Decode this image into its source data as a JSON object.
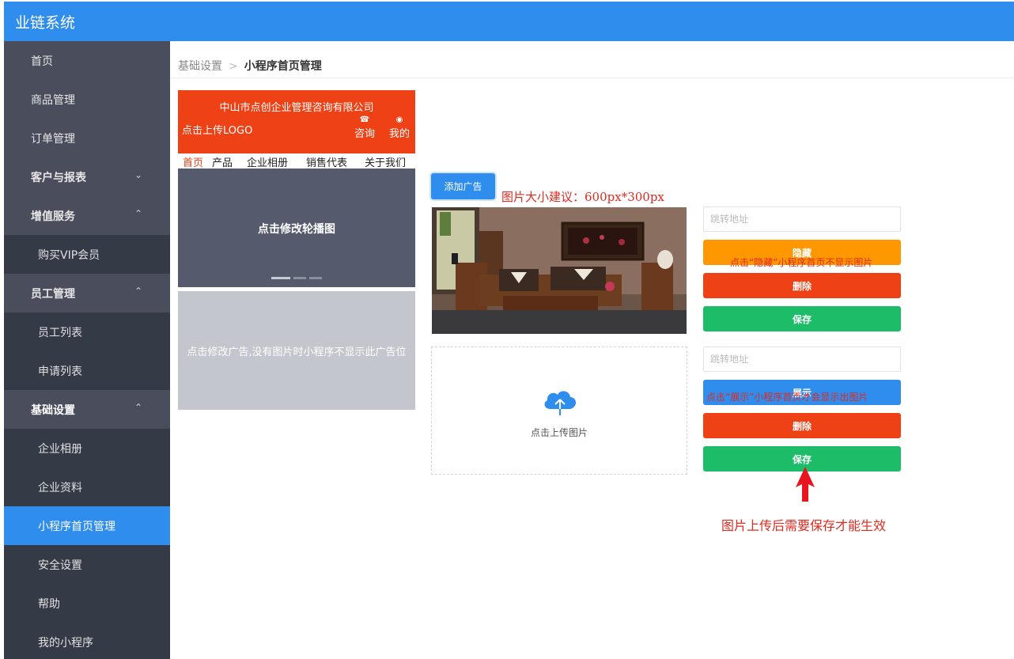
{
  "app": {
    "title": "业链系统"
  },
  "sidebar": {
    "items": [
      {
        "label": "首页"
      },
      {
        "label": "商品管理"
      },
      {
        "label": "订单管理"
      },
      {
        "label": "客户与报表",
        "arrow": "⌄"
      },
      {
        "label": "增值服务",
        "arrow": "⌃"
      },
      {
        "label": "购买VIP会员"
      },
      {
        "label": "员工管理",
        "arrow": "⌃"
      },
      {
        "label": "员工列表"
      },
      {
        "label": "申请列表"
      },
      {
        "label": "基础设置",
        "arrow": "⌃"
      },
      {
        "label": "企业相册"
      },
      {
        "label": "企业资料"
      },
      {
        "label": "小程序首页管理"
      },
      {
        "label": "安全设置"
      },
      {
        "label": "帮助"
      },
      {
        "label": "我的小程序"
      }
    ]
  },
  "breadcrumb": {
    "parent": "基础设置",
    "separator": ">",
    "current": "小程序首页管理"
  },
  "preview": {
    "company": "中山市点创企业管理咨询有限公司",
    "logo_text": "点击上传LOGO",
    "consult": "咨询",
    "mine": "我的",
    "nav": [
      "首页",
      "产品",
      "企业相册",
      "销售代表",
      "关于我们"
    ],
    "carousel_text": "点击修改轮播图",
    "ad_text": "点击修改广告,没有图片时小程序不显示此广告位"
  },
  "ads": {
    "add_label": "添加广告",
    "size_tip": "图片大小建议：600px*300px",
    "upload_text": "点击上传图片",
    "jump_placeholder": "跳转地址",
    "hide_label": "隐藏",
    "show_label": "展示",
    "delete_label": "删除",
    "save_label": "保存",
    "hide_note": "点击“隐藏”小程序首页不显示图片",
    "show_note": "点击“展示”小程序首页才会显示出图片",
    "save_tip": "图片上传后需要保存才能生效"
  },
  "colors": {
    "brand": "#2f8ded",
    "accent": "#ee4115",
    "sidebar": "#393d49",
    "success": "#1cbc68",
    "warning": "#ff9800"
  }
}
